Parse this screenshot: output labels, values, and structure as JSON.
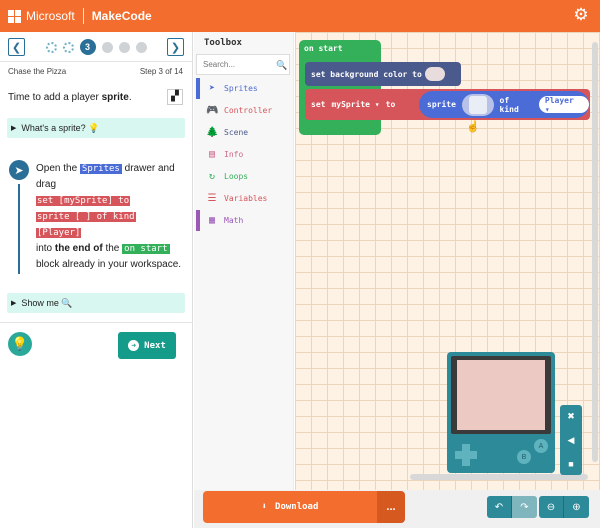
{
  "header": {
    "brand": "Microsoft",
    "app": "MakeCode",
    "settings_icon": "gear-icon"
  },
  "tutorial": {
    "current_step_number": "3",
    "title": "Chase the Pizza",
    "step_label": "Step 3 of 14",
    "hint_prefix": "Time to add a player ",
    "hint_bold": "sprite",
    "hint_suffix": ".",
    "expander_1": "What's a sprite? 💡",
    "instruction": {
      "p1": "Open the ",
      "sprites_tag": "Sprites",
      "p2": " drawer and drag",
      "code_1": "set [mySprite] to",
      "code_2": "sprite [ ] of kind",
      "code_3": "[Player]",
      "p3": "into ",
      "bold_end": "the end of",
      "p4": " the ",
      "onstart_tag": "on start",
      "p5": "block already in your workspace."
    },
    "expander_2": "Show me 🔍",
    "next_label": "Next"
  },
  "toolbox": {
    "title": "Toolbox",
    "search_placeholder": "Search...",
    "categories": [
      {
        "label": "Sprites",
        "color": "#4b6bd6"
      },
      {
        "label": "Controller",
        "color": "#d6555b"
      },
      {
        "label": "Scene",
        "color": "#4b5a8c"
      },
      {
        "label": "Info",
        "color": "#cf6a87"
      },
      {
        "label": "Loops",
        "color": "#35b05a"
      },
      {
        "label": "Variables",
        "color": "#d6555b"
      },
      {
        "label": "Math",
        "color": "#9b59b6"
      }
    ]
  },
  "workspace": {
    "on_start": "on start",
    "set_bg": "set background color to",
    "set_word": "set",
    "var_name": "mySprite ▾",
    "to_word": "to",
    "sprite_word": "sprite",
    "of_kind": "of kind",
    "kind_value": "Player ▾"
  },
  "bottom": {
    "download_label": "Download",
    "more": "..."
  }
}
